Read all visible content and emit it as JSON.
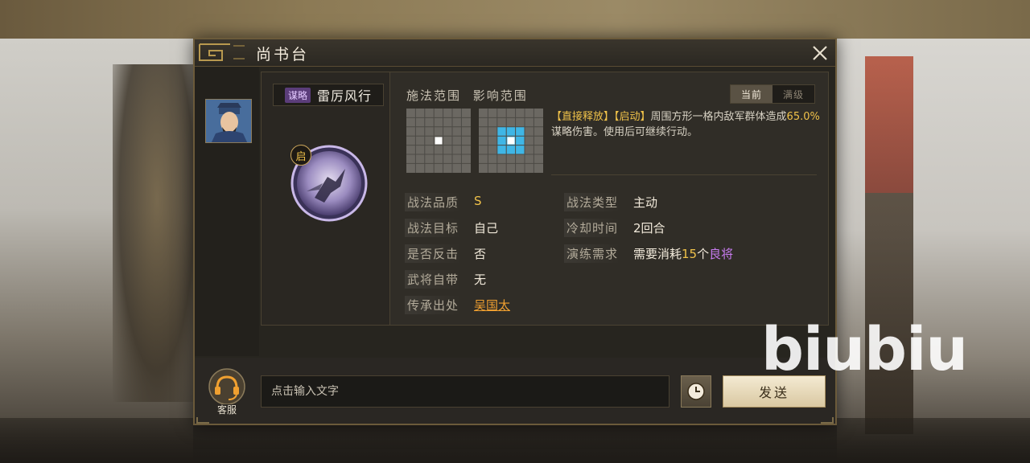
{
  "dialog": {
    "title": "尚书台"
  },
  "skill": {
    "type_tag": "谋略",
    "name": "雷厉风行",
    "orb_badge": "启"
  },
  "range": {
    "cast_label": "施法范围",
    "effect_label": "影响范围",
    "tabs": [
      {
        "label": "当前",
        "active": true
      },
      {
        "label": "满级",
        "active": false
      }
    ]
  },
  "description": {
    "tag1": "【直接释放】",
    "tag2": "【启动】",
    "text_a": "周围方形一格内敌军群体造成",
    "percent": "65.0%",
    "text_b": "谋略伤害。使用后可继续行动。"
  },
  "attributes": {
    "quality_label": "战法品质",
    "quality_value": "S",
    "target_label": "战法目标",
    "target_value": "自己",
    "counter_label": "是否反击",
    "counter_value": "否",
    "innate_label": "武将自带",
    "innate_value": "无",
    "source_label": "传承出处",
    "source_value": "吴国太",
    "type_label": "战法类型",
    "type_value": "主动",
    "cooldown_label": "冷却时间",
    "cooldown_value": "2回合",
    "train_label": "演练需求",
    "train_value_a": "需要消耗",
    "train_count": "15",
    "train_value_b": "个",
    "train_rank": "良将"
  },
  "chat": {
    "support_label": "客服",
    "input_placeholder": "点击输入文字",
    "send_label": "发送"
  },
  "watermark": "biubiu",
  "colors": {
    "accent_gold": "#f0c24a",
    "link_orange": "#f0a030",
    "rank_purple": "#c87cf0",
    "grid_highlight": "#3fb6e6"
  }
}
